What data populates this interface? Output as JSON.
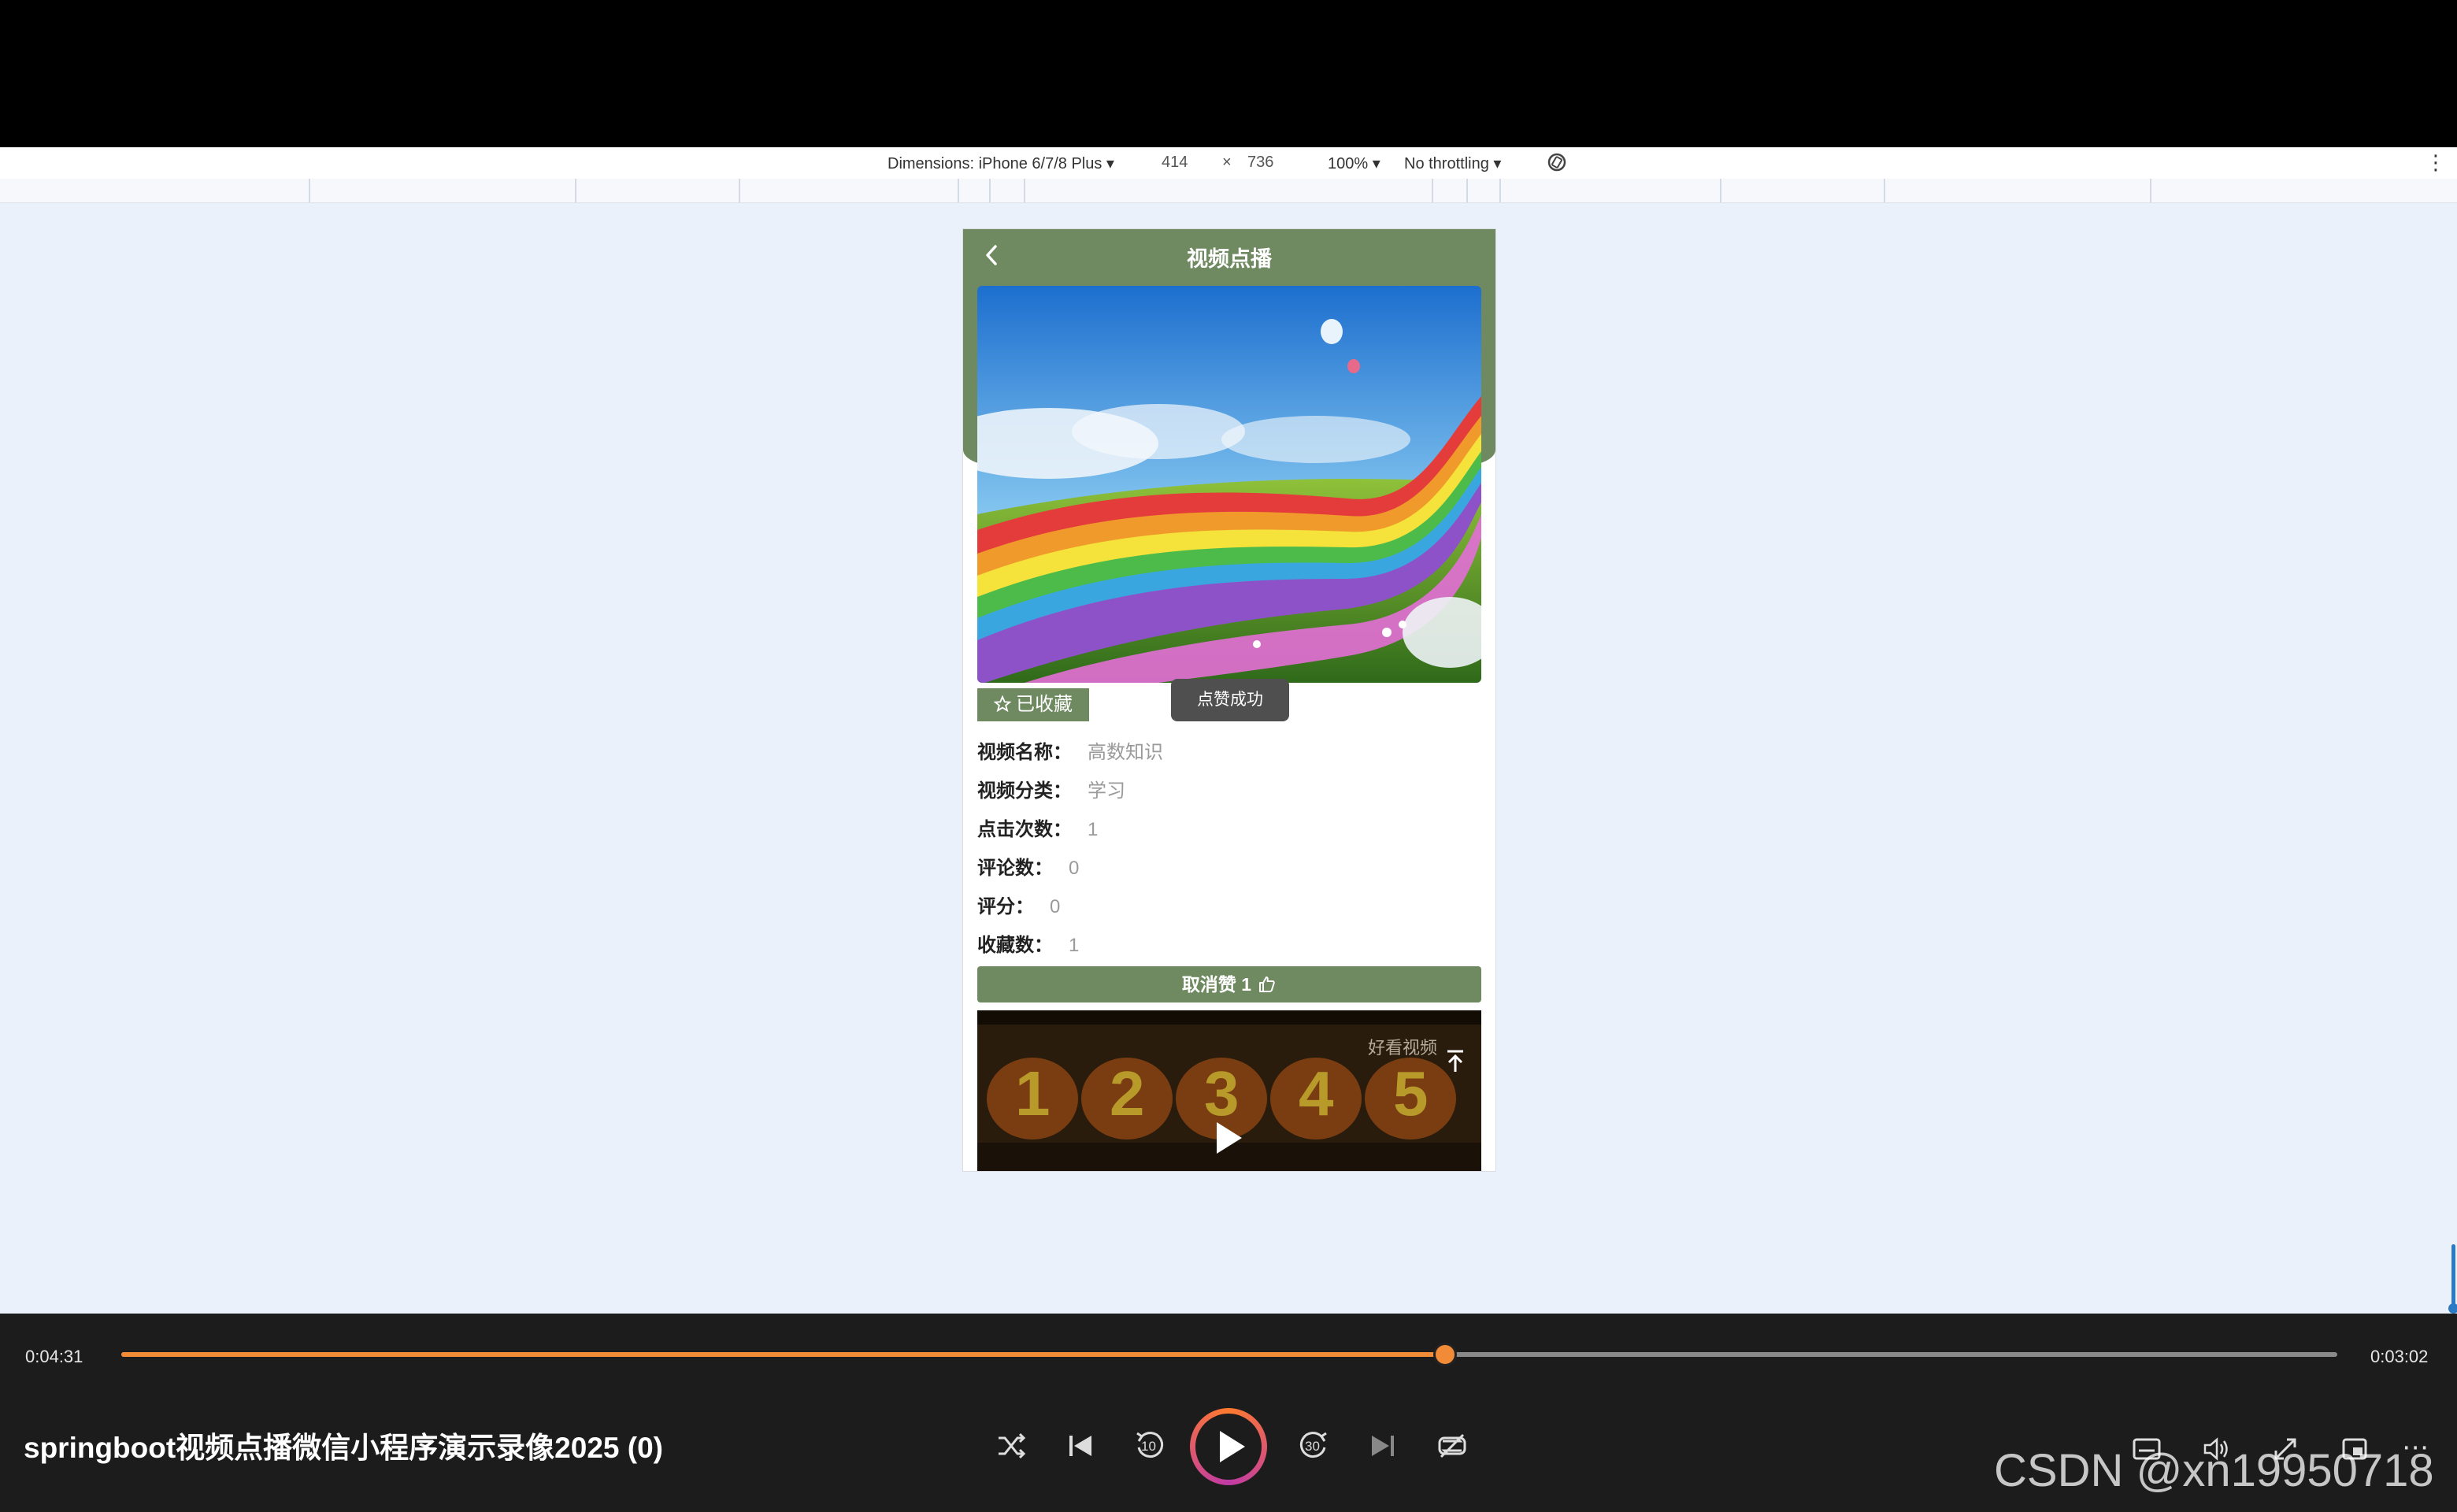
{
  "devtools": {
    "dimensions_label": "Dimensions: iPhone 6/7/8 Plus ▾",
    "width": "414",
    "times": "×",
    "height": "736",
    "zoom": "100% ▾",
    "throttling": "No throttling ▾"
  },
  "app": {
    "nav_title": "视频点播",
    "favorite_label": "已收藏",
    "toast": "点赞成功",
    "fields": [
      {
        "label": "视频名称：",
        "value": "高数知识"
      },
      {
        "label": "视频分类：",
        "value": "学习"
      },
      {
        "label": "点击次数：",
        "value": "1"
      },
      {
        "label": "评论数：",
        "value": "0"
      },
      {
        "label": "评分：",
        "value": "0"
      },
      {
        "label": "收藏数：",
        "value": "1"
      }
    ],
    "like_button": "取消赞 1",
    "video_numbers": [
      "1",
      "2",
      "3",
      "4",
      "5"
    ],
    "video_watermark": "好看视频"
  },
  "player": {
    "elapsed": "0:04:31",
    "remaining": "0:03:02",
    "progress_fraction": 0.5975,
    "title": "springboot视频点播微信小程序演示录像2025 (0)",
    "skip_back": "10",
    "skip_forward": "30"
  },
  "watermark": "CSDN @xn19950718",
  "colors": {
    "accent_green": "#6f8a61",
    "progress_orange": "#f28b38"
  }
}
